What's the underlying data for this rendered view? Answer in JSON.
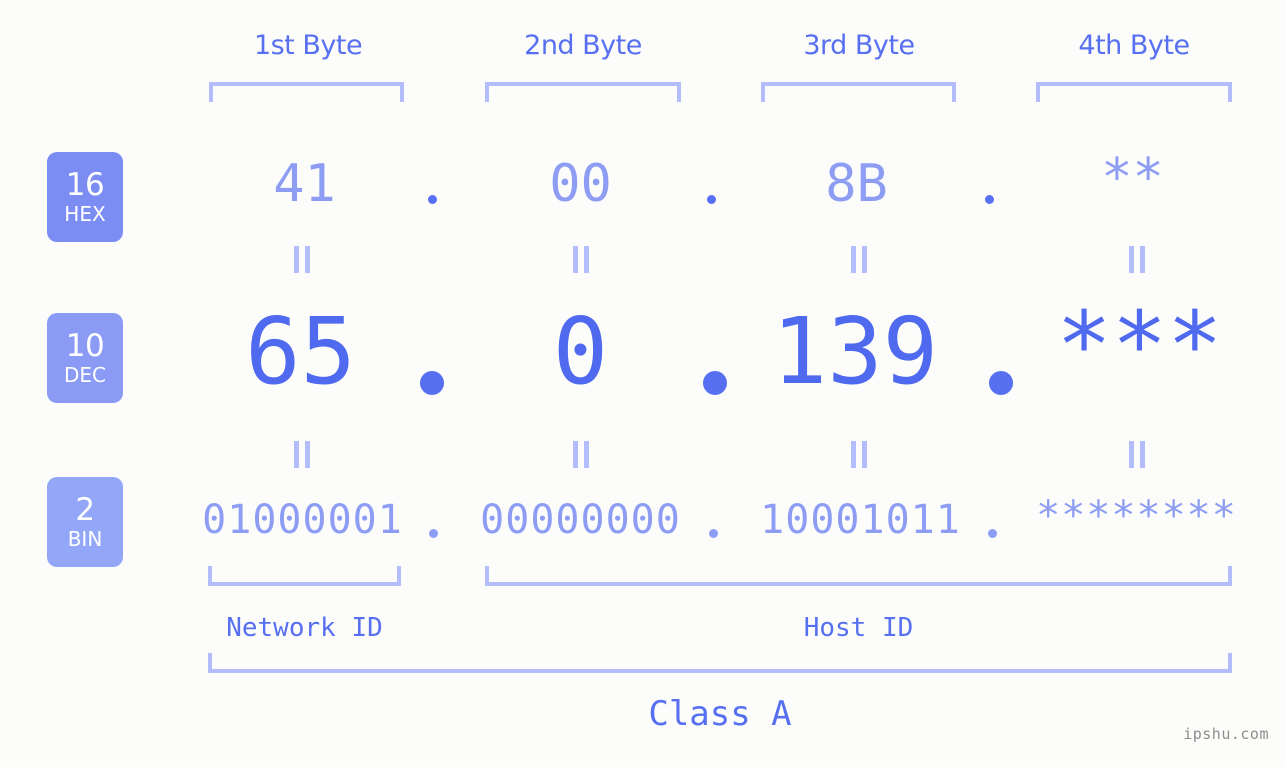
{
  "background_color": "#fcfdfa",
  "accent_color": "#5770f2",
  "accent_light": "#8e9df4",
  "accent_pale": "#b4bdfb",
  "byte_headers": [
    {
      "label": "1st Byte"
    },
    {
      "label": "2nd Byte"
    },
    {
      "label": "3rd Byte"
    },
    {
      "label": "4th Byte"
    }
  ],
  "radix_badges": [
    {
      "number": "16",
      "abbr": "HEX",
      "color": "#7b8cf2"
    },
    {
      "number": "10",
      "abbr": "DEC",
      "color": "#8b9bf5"
    },
    {
      "number": "2",
      "abbr": "BIN",
      "color": "#93a6f7"
    }
  ],
  "rows": {
    "hex": {
      "name": "HEX",
      "values": [
        "41",
        "00",
        "8B",
        "**"
      ],
      "separator": "."
    },
    "dec": {
      "name": "DEC",
      "values": [
        "65",
        "0",
        "139",
        "***"
      ],
      "separator": "."
    },
    "bin": {
      "name": "BIN",
      "values": [
        "01000001",
        "00000000",
        "10001011",
        "********"
      ],
      "separator": "."
    }
  },
  "equals_marks": {
    "symbol": "||",
    "count_per_row": 4
  },
  "segments": {
    "network_id": "Network ID",
    "host_id": "Host ID",
    "class": "Class A"
  },
  "watermark": "ipshu.com"
}
